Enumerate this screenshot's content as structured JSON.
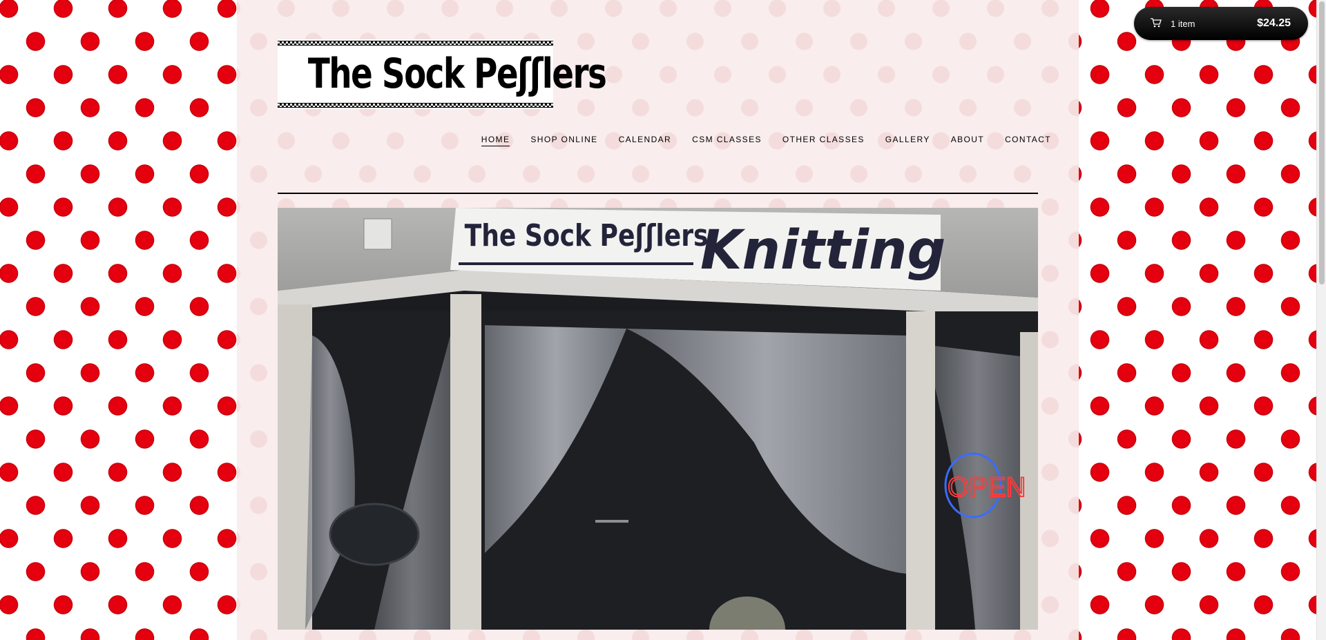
{
  "site": {
    "logo_text": "The Sock Peʃʃlers"
  },
  "nav": {
    "items": [
      {
        "label": "HOME",
        "active": true
      },
      {
        "label": "SHOP ONLINE"
      },
      {
        "label": "CALENDAR"
      },
      {
        "label": "CSM CLASSES"
      },
      {
        "label": "OTHER CLASSES"
      },
      {
        "label": "GALLERY"
      },
      {
        "label": "ABOUT"
      },
      {
        "label": "CONTACT"
      }
    ]
  },
  "cart": {
    "count_label": "1 item",
    "total": "$24.25"
  },
  "hero": {
    "sign_left": "The Sock Peʃʃlers",
    "sign_right": "Knitting",
    "open_sign": "OPEN"
  },
  "colors": {
    "polka_dot": "#e4000f",
    "page_background": "#f9eded",
    "cart_background": "#000000"
  }
}
